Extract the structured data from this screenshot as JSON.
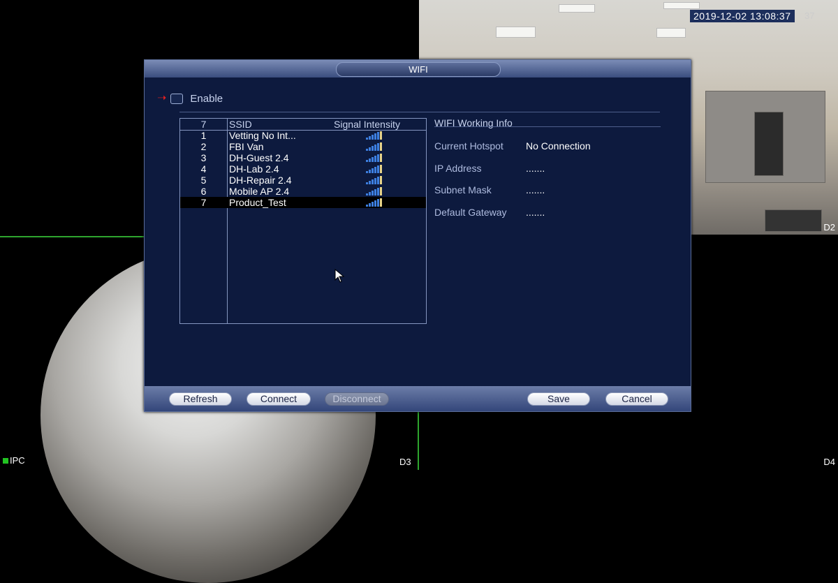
{
  "overlay": {
    "timestamp": "2019-12-02 13:08:37",
    "timestamp_extra": "37",
    "tiles": {
      "d2": "D2",
      "d3": "D3",
      "d4": "D4",
      "ipc": "IPC"
    }
  },
  "dialog": {
    "title": "WIFI",
    "enable_label": "Enable",
    "enable_checked": false,
    "list": {
      "header": {
        "count": "7",
        "ssid": "SSID",
        "signal": "Signal Intensity"
      },
      "rows": [
        {
          "num": "1",
          "ssid": "Vetting No Int...",
          "signal": 4
        },
        {
          "num": "2",
          "ssid": "FBI Van",
          "signal": 4
        },
        {
          "num": "3",
          "ssid": "DH-Guest 2.4",
          "signal": 4
        },
        {
          "num": "4",
          "ssid": "DH-Lab 2.4",
          "signal": 4
        },
        {
          "num": "5",
          "ssid": "DH-Repair 2.4",
          "signal": 4
        },
        {
          "num": "6",
          "ssid": "Mobile AP 2.4",
          "signal": 4
        },
        {
          "num": "7",
          "ssid": "Product_Test",
          "signal": 4
        }
      ],
      "selected_row": 6
    },
    "info": {
      "title": "WIFI Working Info",
      "current_hotspot_label": "Current Hotspot",
      "current_hotspot_value": "No Connection",
      "ip_label": "IP Address",
      "ip_value": ".......",
      "subnet_label": "Subnet Mask",
      "subnet_value": ".......",
      "gateway_label": "Default Gateway",
      "gateway_value": "......."
    },
    "buttons": {
      "refresh": "Refresh",
      "connect": "Connect",
      "disconnect": "Disconnect",
      "save": "Save",
      "cancel": "Cancel"
    }
  },
  "colors": {
    "dialog_bg": "#0d1a3e",
    "signal_bar": "#3d7fe0",
    "signal_peak": "#e8d48a",
    "arrow": "#e02020"
  },
  "icons": {
    "enable_pointer": "red-arrow-icon",
    "signal": "signal-bars-icon",
    "cursor": "mouse-pointer-icon"
  }
}
